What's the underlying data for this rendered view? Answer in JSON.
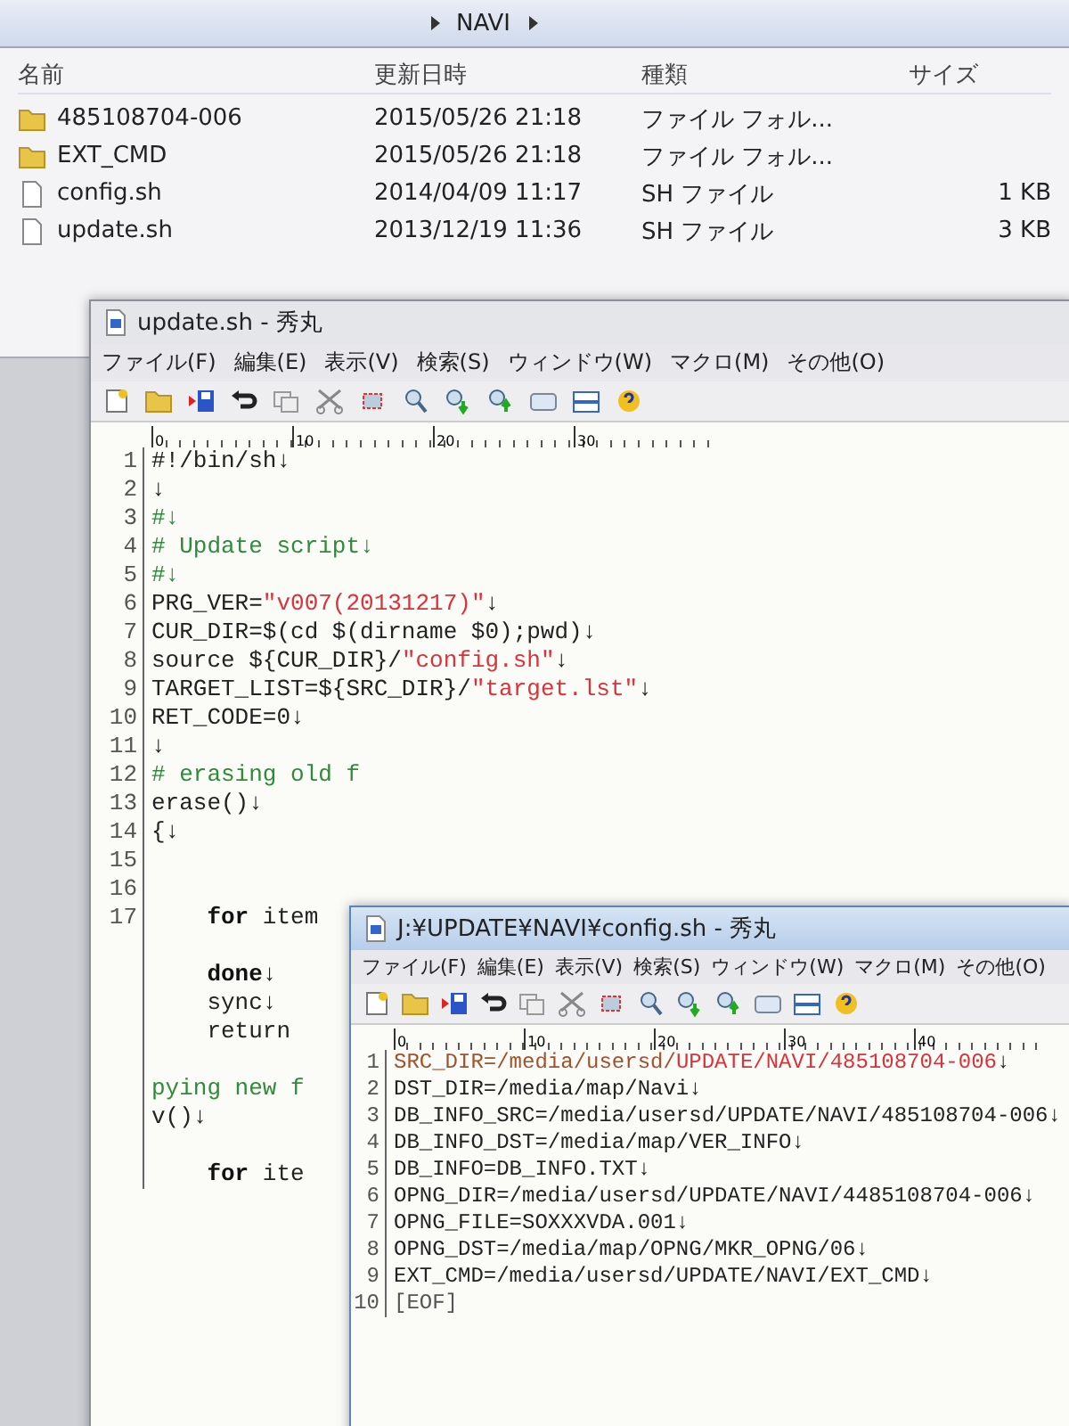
{
  "explorer": {
    "breadcrumb": [
      "NAVI"
    ],
    "columns": [
      "名前",
      "更新日時",
      "種類",
      "サイズ"
    ],
    "rows": [
      {
        "kind": "folder",
        "name": "485108704-006",
        "modified": "2015/05/26 21:18",
        "type": "ファイル フォル..."
      },
      {
        "kind": "folder",
        "name": "EXT_CMD",
        "modified": "2015/05/26 21:18",
        "type": "ファイル フォル..."
      },
      {
        "kind": "file",
        "name": "config.sh",
        "modified": "2014/04/09 11:17",
        "type": "SH ファイル",
        "size": "1 KB"
      },
      {
        "kind": "file",
        "name": "update.sh",
        "modified": "2013/12/19 11:36",
        "type": "SH ファイル",
        "size": "3 KB"
      }
    ]
  },
  "editors": [
    {
      "title": "update.sh - 秀丸",
      "active": false,
      "menu": [
        "ファイル(F)",
        "編集(E)",
        "表示(V)",
        "検索(S)",
        "ウィンドウ(W)",
        "マクロ(M)",
        "その他(O)"
      ],
      "ruler": [
        "0",
        "10",
        "20",
        "30"
      ],
      "lines": [
        {
          "number": "1",
          "segments": [
            {
              "kind": "plain",
              "text": "#!/bin/sh↓"
            }
          ]
        },
        {
          "number": "2",
          "segments": [
            {
              "kind": "plain",
              "text": "↓"
            }
          ]
        },
        {
          "number": "3",
          "segments": [
            {
              "kind": "comment",
              "text": "#↓"
            }
          ]
        },
        {
          "number": "4",
          "segments": [
            {
              "kind": "comment",
              "text": "# Update script↓"
            }
          ]
        },
        {
          "number": "5",
          "segments": [
            {
              "kind": "comment",
              "text": "#↓"
            }
          ]
        },
        {
          "number": "6",
          "segments": [
            {
              "kind": "plain",
              "text": "PRG_VER="
            },
            {
              "kind": "string",
              "text": "\"v007(20131217)\""
            },
            {
              "kind": "plain",
              "text": "↓"
            }
          ]
        },
        {
          "number": "7",
          "segments": [
            {
              "kind": "plain",
              "text": "CUR_DIR=$(cd $(dirname $0);pwd)↓"
            }
          ]
        },
        {
          "number": "8",
          "segments": [
            {
              "kind": "plain",
              "text": "source ${CUR_DIR}/"
            },
            {
              "kind": "string",
              "text": "\"config.sh\""
            },
            {
              "kind": "plain",
              "text": "↓"
            }
          ]
        },
        {
          "number": "9",
          "segments": [
            {
              "kind": "plain",
              "text": "TARGET_LIST=${SRC_DIR}/"
            },
            {
              "kind": "string",
              "text": "\"target.lst\""
            },
            {
              "kind": "plain",
              "text": "↓"
            }
          ]
        },
        {
          "number": "10",
          "segments": [
            {
              "kind": "plain",
              "text": "RET_CODE=0↓"
            }
          ]
        },
        {
          "number": "11",
          "segments": [
            {
              "kind": "plain",
              "text": "↓"
            }
          ]
        },
        {
          "number": "12",
          "segments": [
            {
              "kind": "comment",
              "text": "# erasing old f"
            }
          ]
        },
        {
          "number": "13",
          "segments": [
            {
              "kind": "plain",
              "text": "erase()↓"
            }
          ]
        },
        {
          "number": "14",
          "segments": [
            {
              "kind": "plain",
              "text": "{↓"
            }
          ]
        },
        {
          "number": "15"
        },
        {
          "number": "16"
        },
        {
          "number": "17",
          "segments": [
            {
              "kind": "keyword",
              "text": "    for"
            },
            {
              "kind": "plain",
              "text": " item"
            }
          ]
        },
        {
          "break_before": true,
          "segments": [
            {
              "kind": "keyword",
              "text": "    done"
            },
            {
              "kind": "plain",
              "text": "↓"
            }
          ]
        },
        {
          "segments": [
            {
              "kind": "plain",
              "text": "    sync↓"
            }
          ]
        },
        {
          "segments": [
            {
              "kind": "plain",
              "text": "    return"
            }
          ]
        },
        {
          "break_before": true,
          "segments": [
            {
              "kind": "comment",
              "text": "pying new f"
            }
          ]
        },
        {
          "segments": [
            {
              "kind": "plain",
              "text": "v()↓"
            }
          ]
        },
        {
          "break_before": true,
          "segments": [
            {
              "kind": "keyword",
              "text": "    for"
            },
            {
              "kind": "plain",
              "text": " ite"
            }
          ]
        }
      ]
    },
    {
      "title": "J:¥UPDATE¥NAVI¥config.sh - 秀丸",
      "active": true,
      "menu": [
        "ファイル(F)",
        "編集(E)",
        "表示(V)",
        "検索(S)",
        "ウィンドウ(W)",
        "マクロ(M)",
        "その他(O)"
      ],
      "ruler": [
        "0",
        "10",
        "20",
        "30",
        "40"
      ],
      "lines": [
        {
          "number": "1",
          "segments": [
            {
              "kind": "cursor",
              "text": "SRC_DIR=/media/usersd/"
            },
            {
              "kind": "string",
              "text": "UPDATE/NAVI/485108704-006"
            },
            {
              "kind": "plain",
              "text": "↓"
            }
          ]
        },
        {
          "number": "2",
          "segments": [
            {
              "kind": "plain",
              "text": "DST_DIR=/media/map/Navi↓"
            }
          ]
        },
        {
          "number": "3",
          "segments": [
            {
              "kind": "plain",
              "text": "DB_INFO_SRC=/media/usersd/UPDATE/NAVI/485108704-006↓"
            }
          ]
        },
        {
          "number": "4",
          "segments": [
            {
              "kind": "plain",
              "text": "DB_INFO_DST=/media/map/VER_INFO↓"
            }
          ]
        },
        {
          "number": "5",
          "segments": [
            {
              "kind": "plain",
              "text": "DB_INFO=DB_INFO.TXT↓"
            }
          ]
        },
        {
          "number": "6",
          "segments": [
            {
              "kind": "plain",
              "text": "OPNG_DIR=/media/usersd/UPDATE/NAVI/4485108704-006↓"
            }
          ]
        },
        {
          "number": "7",
          "segments": [
            {
              "kind": "plain",
              "text": "OPNG_FILE=SOXXXVDA.001↓"
            }
          ]
        },
        {
          "number": "8",
          "segments": [
            {
              "kind": "plain",
              "text": "OPNG_DST=/media/map/OPNG/MKR_OPNG/06↓"
            }
          ]
        },
        {
          "number": "9",
          "segments": [
            {
              "kind": "plain",
              "text": "EXT_CMD=/media/usersd/UPDATE/NAVI/EXT_CMD↓"
            }
          ]
        },
        {
          "number": "10",
          "segments": [
            {
              "kind": "eof",
              "text": "[EOF]"
            }
          ]
        }
      ]
    }
  ]
}
